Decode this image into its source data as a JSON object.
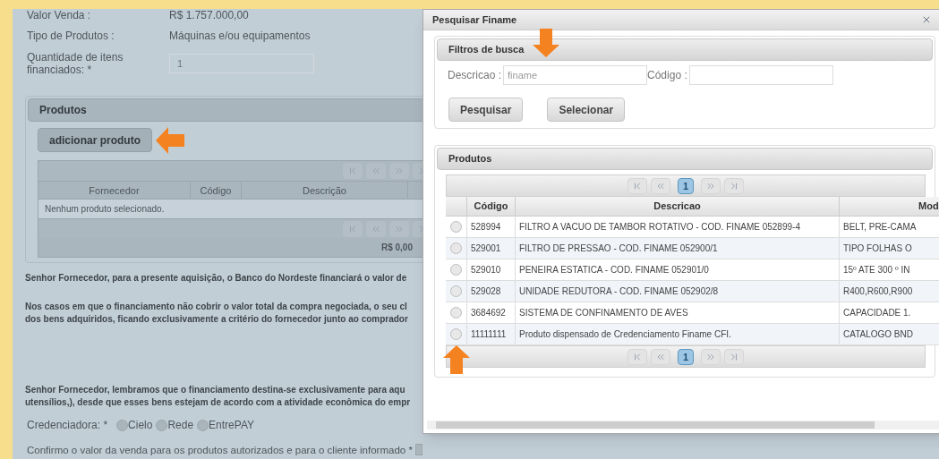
{
  "page": {
    "fields": [
      {
        "label": "Valor Venda :",
        "value": "R$ 1.757.000,00"
      },
      {
        "label": "Tipo de Produtos :",
        "value": "Máquinas e/ou equipamentos"
      }
    ],
    "quantity": {
      "label": "Quantidade de itens financiados: *",
      "value": "1"
    },
    "products_panel": {
      "title": "Produtos",
      "add_button": "adicionar produto",
      "columns": [
        "Fornecedor",
        "Código",
        "Descrição"
      ],
      "empty_message": "Nenhum produto selecionado.",
      "total": "R$ 0,00"
    },
    "paragraphs": [
      {
        "lines": [
          "Senhor Fornecedor, para a presente aquisição, o Banco do Nordeste financiará o valor de"
        ]
      },
      {
        "lines": [
          "Nos casos em que o financiamento não cobrir o valor total da compra negociada, o seu cl",
          "dos bens adquiridos, ficando exclusivamente a critério do fornecedor junto ao comprador"
        ]
      },
      {
        "lines": [
          "Senhor Fornecedor, lembramos que o financiamento destina-se exclusivamente para aqu",
          "utensílios,), desde que esses bens estejam de acordo com a atividade econômica do empr"
        ]
      }
    ],
    "credenciadora": {
      "label": "Credenciadora: *",
      "options": [
        {
          "label": "Cielo",
          "selected": false
        },
        {
          "label": "Rede",
          "selected": false
        },
        {
          "label": "EntrePAY",
          "selected": false
        }
      ]
    },
    "confirm": {
      "label": "Confirmo o valor da venda para os produtos autorizados e para o cliente informado *",
      "checked": false
    }
  },
  "dialog": {
    "title": "Pesquisar Finame",
    "filters": {
      "title": "Filtros de busca",
      "fields": [
        {
          "label": "Descricao :",
          "placeholder": "finame"
        },
        {
          "label": "Código :"
        }
      ],
      "buttons": [
        "Pesquisar",
        "Selecionar"
      ]
    },
    "products": {
      "title": "Produtos",
      "top_pages": [
        {
          "label": "1",
          "selected": true
        }
      ],
      "bottom_pages": [
        {
          "label": "1",
          "selected": true
        }
      ],
      "columns": [
        "Código",
        "Descricao",
        "Mod"
      ],
      "rows": [
        {
          "selected": false,
          "cells": [
            "528994",
            "FILTRO A VACUO DE TAMBOR ROTATIVO - COD. FINAME 052899-4",
            "BELT, PRE-CAMA"
          ]
        },
        {
          "selected": false,
          "cells": [
            "529001",
            "FILTRO DE PRESSAO - COD. FINAME 052900/1",
            "TIPO FOLHAS O"
          ]
        },
        {
          "selected": false,
          "cells": [
            "529010",
            "PENEIRA ESTATICA - COD. FINAME 052901/0",
            "15º ATE 300 º IN"
          ]
        },
        {
          "selected": false,
          "cells": [
            "529028",
            "UNIDADE REDUTORA - COD. FINAME 052902/8",
            "R400,R600,R900"
          ]
        },
        {
          "selected": false,
          "cells": [
            "3684692",
            "SISTEMA DE CONFINAMENTO DE AVES",
            "CAPACIDADE 1."
          ]
        },
        {
          "selected": false,
          "cells": [
            "11111111",
            "Produto dispensado de Credenciamento Finame CFI.",
            "CATALOGO BND"
          ]
        }
      ]
    }
  }
}
